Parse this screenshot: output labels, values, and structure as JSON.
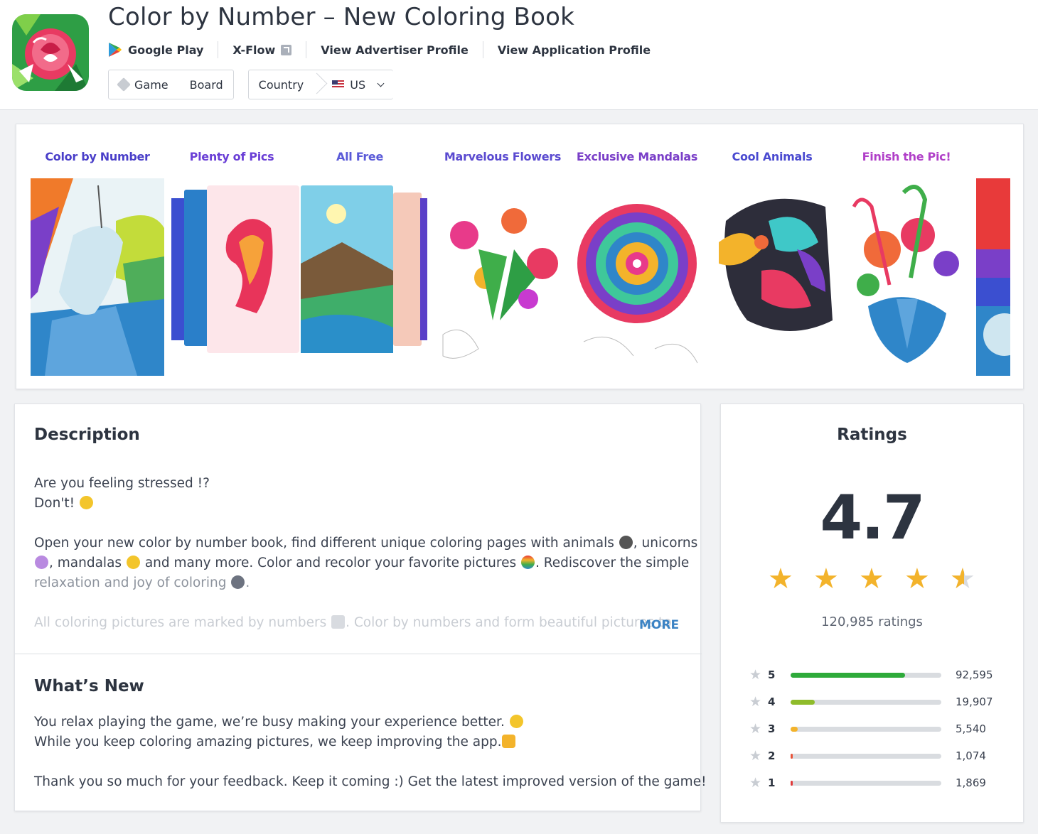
{
  "app": {
    "title": "Color by Number – New Coloring Book"
  },
  "links": {
    "store": "Google Play",
    "network": "X-Flow",
    "advertiser": "View Advertiser Profile",
    "application": "View Application Profile"
  },
  "tags": {
    "category": "Game",
    "subcategory": "Board",
    "country_label": "Country",
    "country_value": "US"
  },
  "screenshots": [
    {
      "caption": "Color by Number",
      "color": "#4a3fc9"
    },
    {
      "caption": "Plenty of Pics",
      "color": "#6a3fd6"
    },
    {
      "caption": "All Free",
      "color": "#5a5ad8"
    },
    {
      "caption": "Marvelous Flowers",
      "color": "#5a4ad0"
    },
    {
      "caption": "Exclusive Mandalas",
      "color": "#7a3fc8"
    },
    {
      "caption": "Cool Animals",
      "color": "#4a4ad0"
    },
    {
      "caption": "Finish the Pic!",
      "color": "#b03fc8"
    }
  ],
  "description": {
    "title": "Description",
    "line1": "Are you feeling stressed !?",
    "line2": "Don't!",
    "p2_line1a": "Open your new color by number book, find different unique coloring pages with animals",
    "p2_line1b": ", unicorns",
    "p2_line2a": ", mandalas",
    "p2_line2b": "and many more. Color and recolor your favorite pictures",
    "p2_line2c": ". Rediscover the simple",
    "p2_line3": "relaxation and joy of coloring",
    "p3_line1a": "All coloring pictures are marked by numbers",
    "p3_line1b": ". Color by numbers and form beautiful pictures to",
    "more_label": "MORE"
  },
  "whats_new": {
    "title": "What’s New",
    "line1": "You relax playing the game, we’re busy making your experience better.",
    "line2": "While you keep coloring amazing pictures, we keep improving the app.",
    "line3": "Thank you so much for your feedback. Keep it coming :) Get the latest improved version of the game!"
  },
  "ratings": {
    "title": "Ratings",
    "score": "4.7",
    "stars_value": 4.7,
    "count_label": "120,985 ratings",
    "breakdown": [
      {
        "star": "5",
        "count": "92,595",
        "fraction": 0.76,
        "color": "#2eaa3a"
      },
      {
        "star": "4",
        "count": "19,907",
        "fraction": 0.16,
        "color": "#8fbc2b"
      },
      {
        "star": "3",
        "count": "5,540",
        "fraction": 0.045,
        "color": "#f3b32b"
      },
      {
        "star": "2",
        "count": "1,074",
        "fraction": 0.012,
        "color": "#e8543a"
      },
      {
        "star": "1",
        "count": "1,869",
        "fraction": 0.015,
        "color": "#e03b3b"
      }
    ]
  }
}
